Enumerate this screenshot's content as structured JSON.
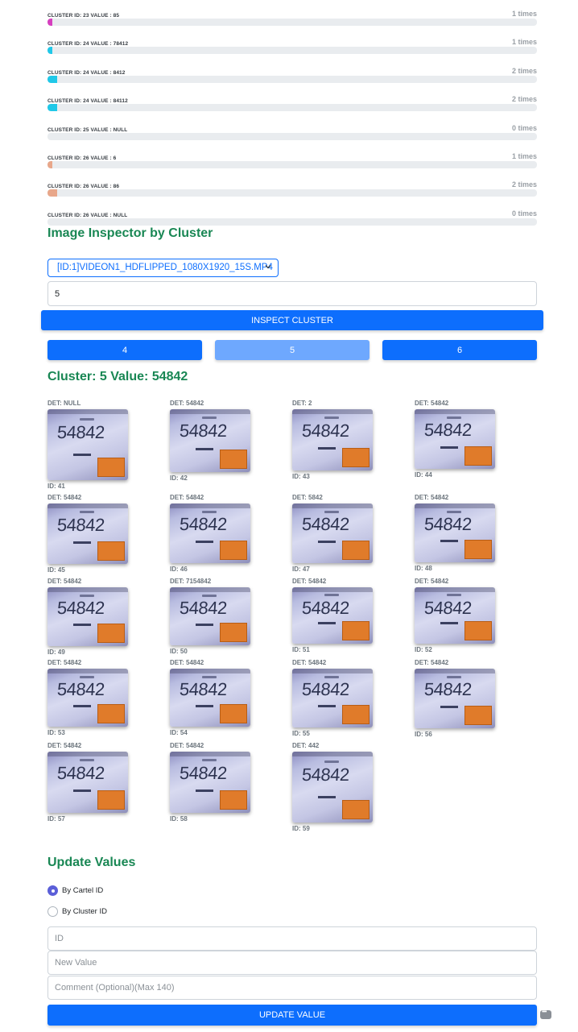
{
  "cluster_bars": [
    {
      "label": "CLUSTER ID: 23 VALUE : 85",
      "times": "1 times",
      "fill_fraction": 0.01,
      "color": "#d63fbf"
    },
    {
      "label": "CLUSTER ID: 24 VALUE : 78412",
      "times": "1 times",
      "fill_fraction": 0.01,
      "color": "#20c8e8"
    },
    {
      "label": "CLUSTER ID: 24 VALUE : 8412",
      "times": "2 times",
      "fill_fraction": 0.02,
      "color": "#20c8e8"
    },
    {
      "label": "CLUSTER ID: 24 VALUE : 84112",
      "times": "2 times",
      "fill_fraction": 0.02,
      "color": "#20c8e8"
    },
    {
      "label": "CLUSTER ID: 25 VALUE : NULL",
      "times": "0 times",
      "fill_fraction": 0,
      "color": "#20c8e8"
    },
    {
      "label": "CLUSTER ID: 26 VALUE : 6",
      "times": "1 times",
      "fill_fraction": 0.01,
      "color": "#e8a78a"
    },
    {
      "label": "CLUSTER ID: 26 VALUE : 86",
      "times": "2 times",
      "fill_fraction": 0.02,
      "color": "#e8a78a"
    },
    {
      "label": "CLUSTER ID: 26 VALUE : NULL",
      "times": "0 times",
      "fill_fraction": 0,
      "color": "#e8a78a"
    }
  ],
  "inspector": {
    "title": "Image Inspector by Cluster",
    "video_select": "[ID:1]VIDEON1_HDFLIPPED_1080X1920_15S.MP4",
    "cluster_input_value": "5",
    "inspect_button": "INSPECT CLUSTER",
    "pager": {
      "prev": "4",
      "current": "5",
      "next": "6"
    },
    "cluster_heading": "Cluster: 5 Value: 54842"
  },
  "detections": [
    {
      "det": "DET: NULL",
      "id": "ID: 41",
      "reading": "54842"
    },
    {
      "det": "DET: 54842",
      "id": "ID: 42",
      "reading": "54842"
    },
    {
      "det": "DET: 2",
      "id": "ID: 43",
      "reading": "54842"
    },
    {
      "det": "DET: 54842",
      "id": "ID: 44",
      "reading": "54842"
    },
    {
      "det": "DET: 54842",
      "id": "ID: 45",
      "reading": "54842"
    },
    {
      "det": "DET: 54842",
      "id": "ID: 46",
      "reading": "54842"
    },
    {
      "det": "DET: 5842",
      "id": "ID: 47",
      "reading": "54842"
    },
    {
      "det": "DET: 54842",
      "id": "ID: 48",
      "reading": "54842"
    },
    {
      "det": "DET: 54842",
      "id": "ID: 49",
      "reading": "54842"
    },
    {
      "det": "DET: 7154842",
      "id": "ID: 50",
      "reading": "54842"
    },
    {
      "det": "DET: 54842",
      "id": "ID: 51",
      "reading": "54842"
    },
    {
      "det": "DET: 54842",
      "id": "ID: 52",
      "reading": "54842"
    },
    {
      "det": "DET: 54842",
      "id": "ID: 53",
      "reading": "54842"
    },
    {
      "det": "DET: 54842",
      "id": "ID: 54",
      "reading": "54842"
    },
    {
      "det": "DET: 54842",
      "id": "ID: 55",
      "reading": "54842"
    },
    {
      "det": "DET: 54842",
      "id": "ID: 56",
      "reading": "54842"
    },
    {
      "det": "DET: 54842",
      "id": "ID: 57",
      "reading": "54842"
    },
    {
      "det": "DET: 54842",
      "id": "ID: 58",
      "reading": "54842"
    },
    {
      "det": "DET: 442",
      "id": "ID: 59",
      "reading": "54842"
    }
  ],
  "update": {
    "title": "Update Values",
    "radio_cartel": "By Cartel ID",
    "radio_cluster": "By Cluster ID",
    "selected": "By Cartel ID",
    "id_placeholder": "ID",
    "new_value_placeholder": "New Value",
    "comment_placeholder": "Comment (Optional)(Max 140)",
    "button": "UPDATE VALUE"
  },
  "colors": {
    "primary": "#0d6efd",
    "primary_light": "#6ea8fe",
    "heading_green": "#198754"
  },
  "icons": [
    "chevron-down-icon",
    "chat-icon"
  ]
}
